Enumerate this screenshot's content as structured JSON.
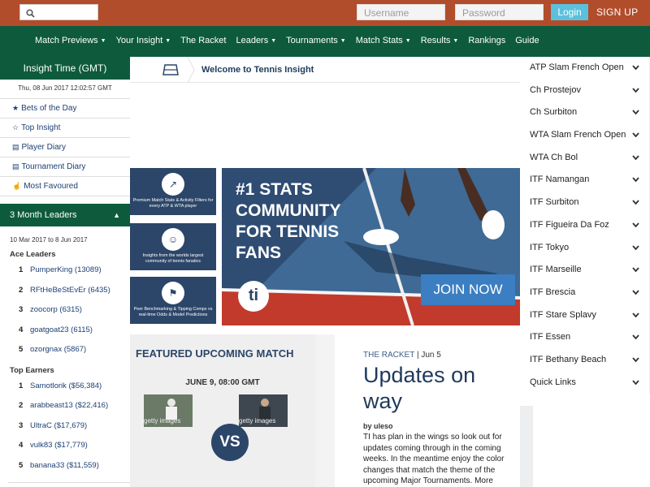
{
  "topbar": {
    "username_placeholder": "Username",
    "password_placeholder": "Password",
    "login_label": "Login",
    "signup_label": "SIGN UP",
    "icons": {
      "search": "search-icon"
    }
  },
  "nav": {
    "items": [
      {
        "label": "Match Previews",
        "dropdown": true
      },
      {
        "label": "Your Insight",
        "dropdown": true
      },
      {
        "label": "The Racket",
        "dropdown": false
      },
      {
        "label": "Leaders",
        "dropdown": true
      },
      {
        "label": "Tournaments",
        "dropdown": true
      },
      {
        "label": "Match Stats",
        "dropdown": true
      },
      {
        "label": "Results",
        "dropdown": true
      },
      {
        "label": "Rankings",
        "dropdown": false
      },
      {
        "label": "Guide",
        "dropdown": false
      }
    ]
  },
  "left": {
    "title": "Insight Time (GMT)",
    "datetime": "Thu, 08 Jun 2017 12:02:57 GMT",
    "links": [
      {
        "label": "Bets of the Day",
        "icon": "star-filled-icon"
      },
      {
        "label": "Top Insight",
        "icon": "star-outline-icon"
      },
      {
        "label": "Player Diary",
        "icon": "book-icon"
      },
      {
        "label": "Tournament Diary",
        "icon": "book-icon"
      },
      {
        "label": "Most Favoured",
        "icon": "thumbs-up-icon"
      }
    ],
    "leaders_title": "3 Month Leaders",
    "range": "10 Mar 2017 to 8 Jun 2017",
    "ace_title": "Ace Leaders",
    "ace": [
      {
        "rank": "1",
        "name": "PumperKing (13089)"
      },
      {
        "rank": "2",
        "name": "RFtHeBeStEvEr (6435)"
      },
      {
        "rank": "3",
        "name": "zoocorp (6315)"
      },
      {
        "rank": "4",
        "name": "goatgoat23 (6115)"
      },
      {
        "rank": "5",
        "name": "ozorgnax (5867)"
      }
    ],
    "earners_title": "Top Earners",
    "earners": [
      {
        "rank": "1",
        "name": "Samotlorik ($56,384)"
      },
      {
        "rank": "2",
        "name": "arabbeast13 ($22,416)"
      },
      {
        "rank": "3",
        "name": "UltraC ($17,679)"
      },
      {
        "rank": "4",
        "name": "vulk83 ($17,779)"
      },
      {
        "rank": "5",
        "name": "banana33 ($11,559)"
      }
    ]
  },
  "right": {
    "tournaments": [
      "ATP Slam French Open",
      "Ch Prostejov",
      "Ch Surbiton",
      "WTA Slam French Open",
      "WTA Ch Bol",
      "ITF Namangan",
      "ITF Surbiton",
      "ITF Figueira Da Foz",
      "ITF Tokyo",
      "ITF Marseille",
      "ITF Brescia",
      "ITF Stare Splavy",
      "ITF Essen",
      "ITF Bethany Beach",
      "Quick Links"
    ]
  },
  "main": {
    "breadcrumb": "Welcome to Tennis Insight",
    "features": [
      {
        "text": "Premium Match Stats & Activity Filters for every ATP & WTA player",
        "icon": "chart-icon"
      },
      {
        "text": "Insights from the worlds largest community of tennis fanatics",
        "icon": "users-icon"
      },
      {
        "text": "Peer Benchmarking & Tipping Comps vs real-time Odds & Model Predictions",
        "icon": "trophy-icon"
      }
    ],
    "promo": {
      "headline": "#1 STATS COMMUNITY FOR TENNIS FANS",
      "logo": "ti",
      "join": "JOIN NOW"
    },
    "featured": {
      "title": "FEATURED UPCOMING MATCH",
      "date": "JUNE 9, 08:00 GMT",
      "player1_caption": "getty images",
      "player2_caption": "getty images",
      "vs": "VS"
    },
    "racket": {
      "section": "THE RACKET",
      "date": "| Jun 5",
      "title": "Updates on way",
      "byline": "by uleso",
      "body": "TI has plan in the wings so look out for updates coming through in the coming weeks. In the meantime enjoy the color changes that match the theme of the upcoming Major Tournaments. More"
    }
  }
}
